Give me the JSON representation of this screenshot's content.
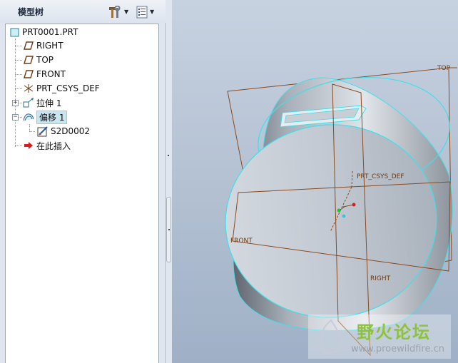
{
  "panel": {
    "title": "模型树"
  },
  "header": {
    "tools_icon": "hammer-wrench-icon",
    "settings_icon": "tree-settings-icon"
  },
  "tree": {
    "root": "PRT0001.PRT",
    "items": [
      {
        "label": "RIGHT",
        "icon": "datum-plane-icon"
      },
      {
        "label": "TOP",
        "icon": "datum-plane-icon"
      },
      {
        "label": "FRONT",
        "icon": "datum-plane-icon"
      },
      {
        "label": "PRT_CSYS_DEF",
        "icon": "csys-icon"
      },
      {
        "label": "拉伸 1",
        "icon": "extrude-icon"
      },
      {
        "label": "偏移 1",
        "icon": "offset-icon"
      },
      {
        "label": "S2D0002",
        "icon": "sketch-icon"
      },
      {
        "label": "在此插入",
        "icon": "insert-arrow-icon"
      }
    ]
  },
  "viewport": {
    "labels": {
      "top": "TOP",
      "csys": "PRT_CSYS_DEF",
      "front": "FRONT",
      "right": "RIGHT"
    },
    "colors": {
      "edge": "#3fe0e8",
      "datum": "#8b4a1e",
      "background": "#b6c3d4"
    }
  },
  "watermark": {
    "cn": "野火论坛",
    "url": "www.proewildfire.cn"
  }
}
